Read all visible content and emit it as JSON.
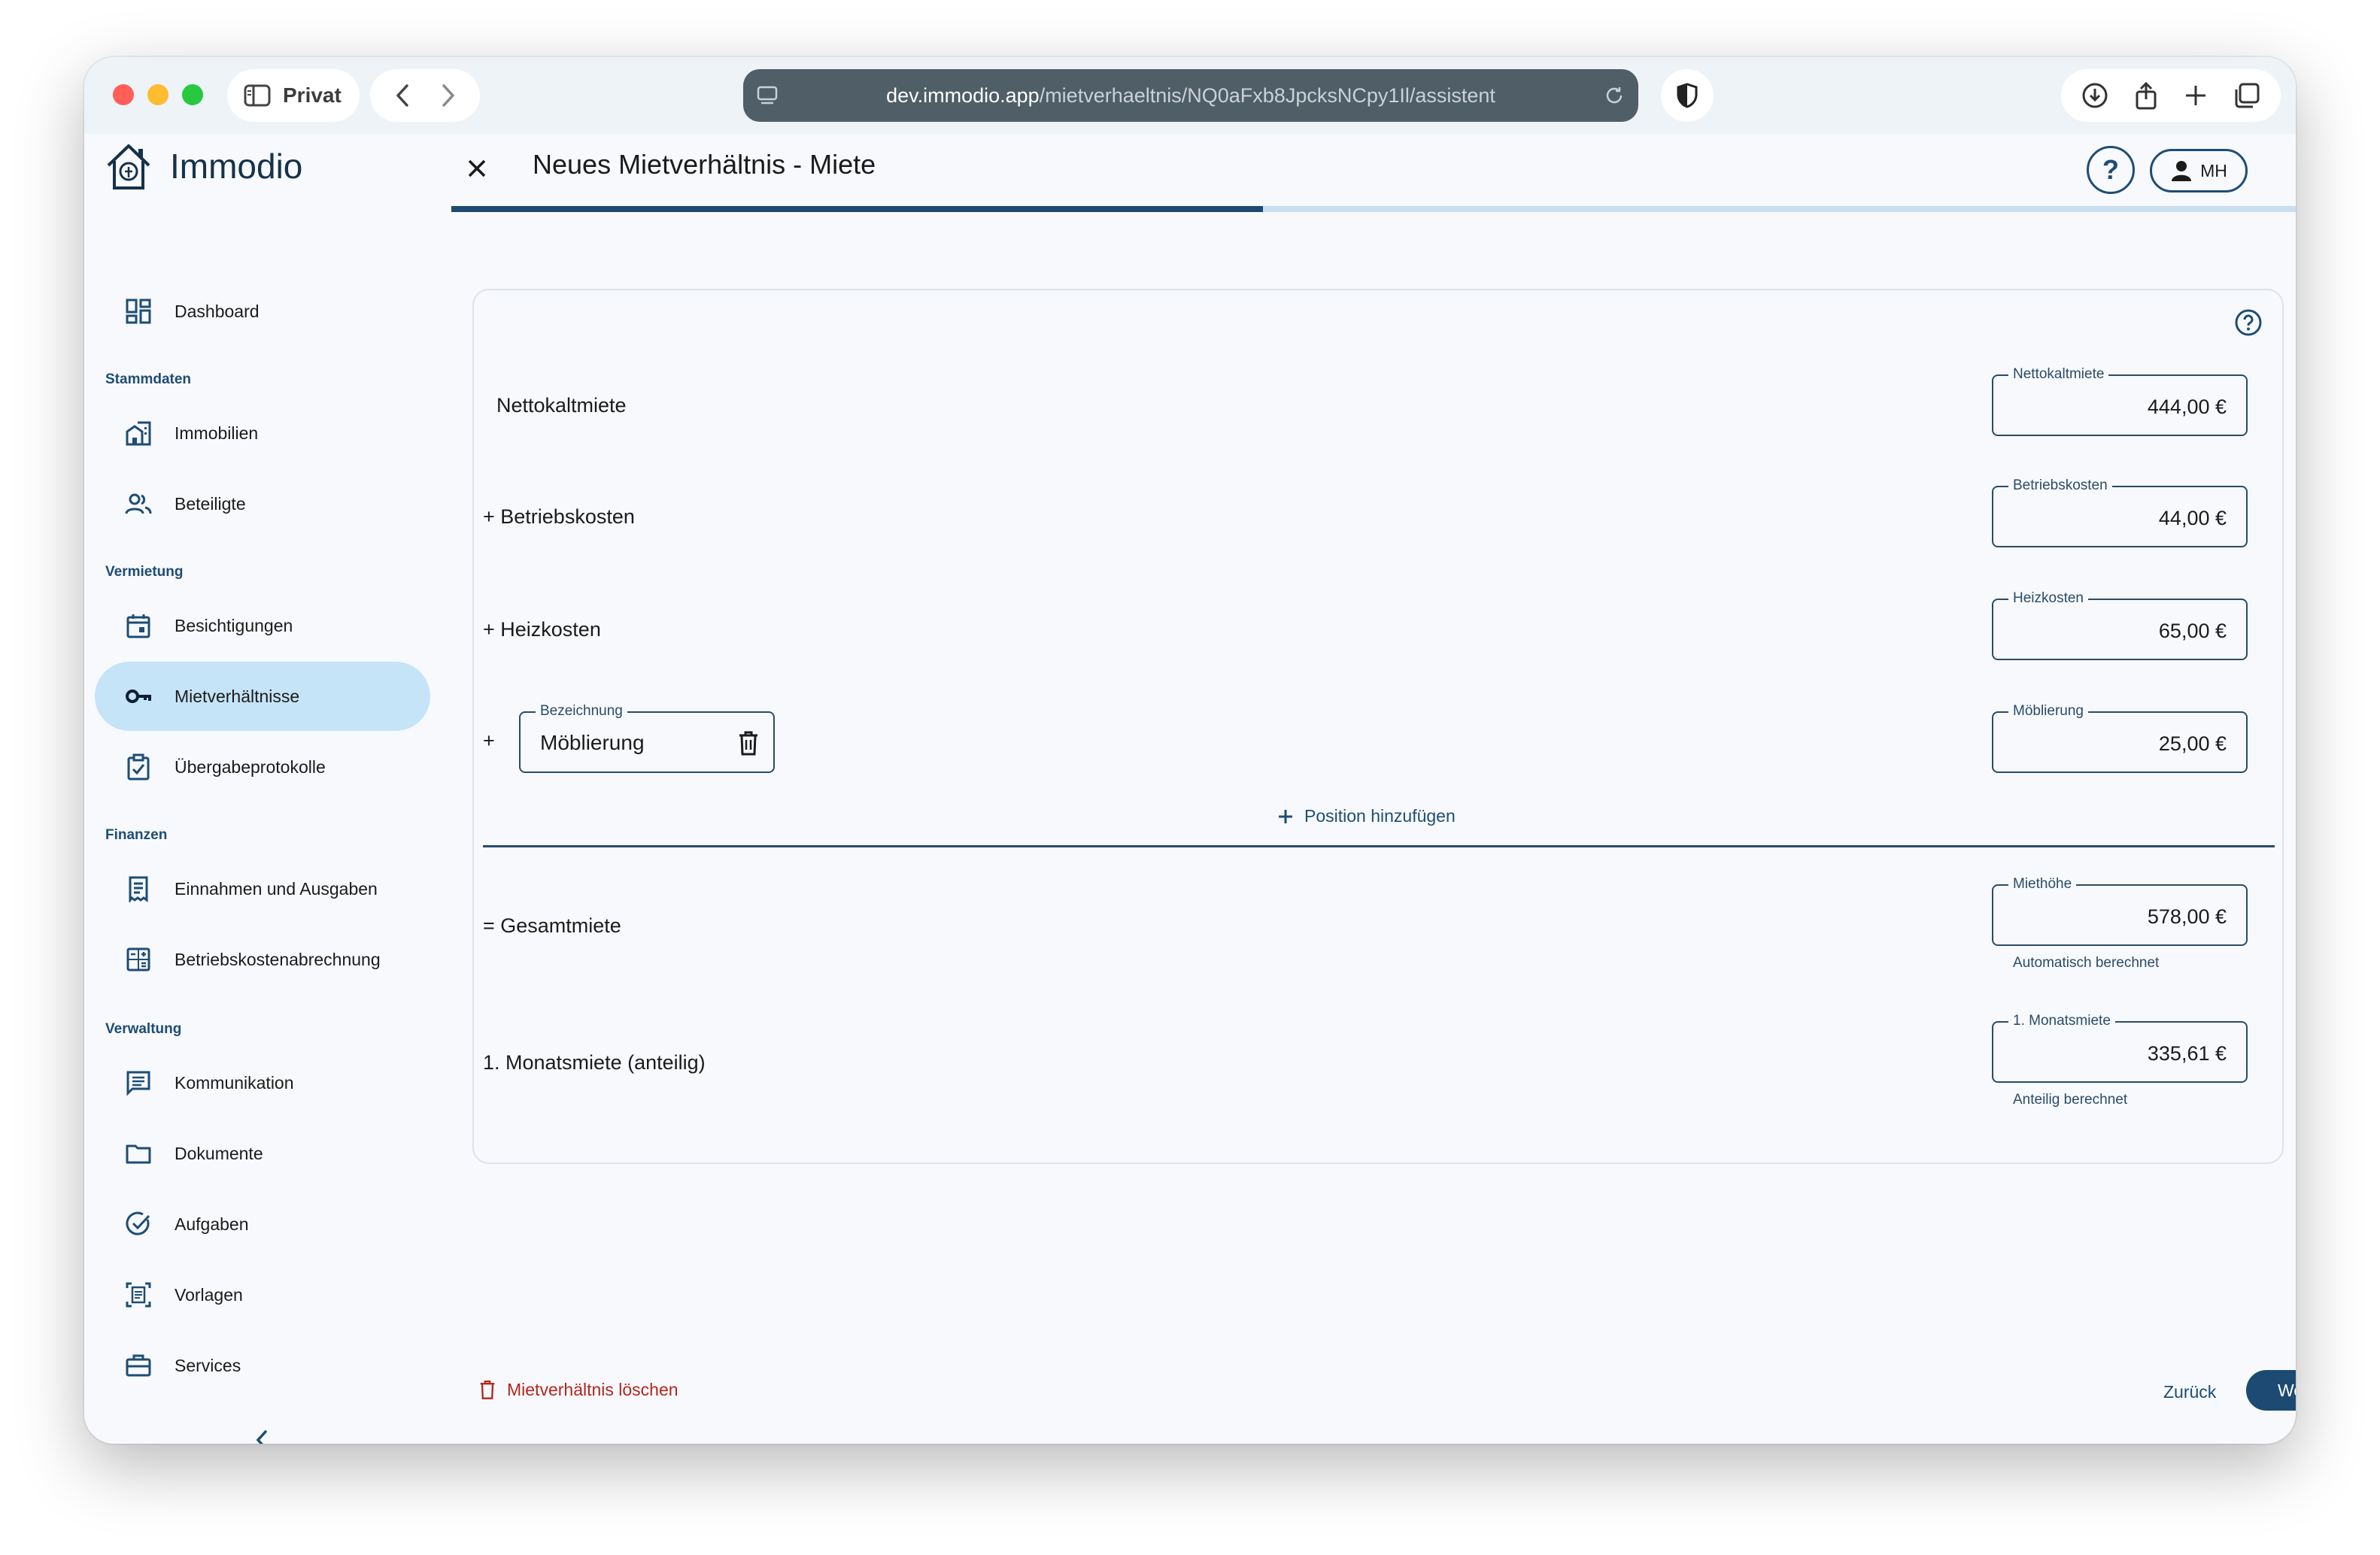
{
  "browser": {
    "profile_label": "Privat",
    "url_host": "dev.immodio.app",
    "url_path": "/mietverhaeltnis/NQ0aFxb8JpcksNCpy1Il/assistent"
  },
  "app": {
    "name": "Immodio"
  },
  "sidebar": {
    "dashboard": "Dashboard",
    "sections": {
      "stammdaten": "Stammdaten",
      "vermietung": "Vermietung",
      "finanzen": "Finanzen",
      "verwaltung": "Verwaltung"
    },
    "items": {
      "immobilien": "Immobilien",
      "beteiligte": "Beteiligte",
      "besichtigungen": "Besichtigungen",
      "mietverhaeltnisse": "Mietverhältnisse",
      "uebergabeprotokolle": "Übergabeprotokolle",
      "einnahmen": "Einnahmen und Ausgaben",
      "betriebskostenabrechnung": "Betriebskostenabrechnung",
      "kommunikation": "Kommunikation",
      "dokumente": "Dokumente",
      "aufgaben": "Aufgaben",
      "vorlagen": "Vorlagen",
      "services": "Services"
    }
  },
  "header": {
    "title": "Neues Mietverhältnis - Miete",
    "help_label": "?",
    "user_initials": "MH",
    "progress": 0.44
  },
  "form": {
    "rows": {
      "nettokaltmiete_label": "Nettokaltmiete",
      "betriebskosten_label": "+ Betriebskosten",
      "heizkosten_label": "+ Heizkosten",
      "custom_prefix": "+",
      "gesamtmiete_label": "= Gesamtmiete",
      "monatsmiete_label": "1. Monatsmiete (anteilig)"
    },
    "fields": {
      "nettokaltmiete": {
        "legend": "Nettokaltmiete",
        "value": "444,00 €"
      },
      "betriebskosten": {
        "legend": "Betriebskosten",
        "value": "44,00 €"
      },
      "heizkosten": {
        "legend": "Heizkosten",
        "value": "65,00 €"
      },
      "moeblierung": {
        "legend": "Möblierung",
        "value": "25,00 €"
      },
      "miethoehe": {
        "legend": "Miethöhe",
        "value": "578,00 €",
        "hint": "Automatisch berechnet"
      },
      "monatsmiete": {
        "legend": "1. Monatsmiete",
        "value": "335,61 €",
        "hint": "Anteilig berechnet"
      }
    },
    "custom_position": {
      "legend": "Bezeichnung",
      "value": "Möblierung"
    },
    "add_position_label": "Position hinzufügen"
  },
  "footer": {
    "delete_label": "Mietverhältnis löschen",
    "back_label": "Zurück",
    "next_label": "Weiter"
  },
  "colors": {
    "primary": "#1d4a72",
    "active_nav": "#c6e4f8",
    "danger": "#b3261e"
  }
}
